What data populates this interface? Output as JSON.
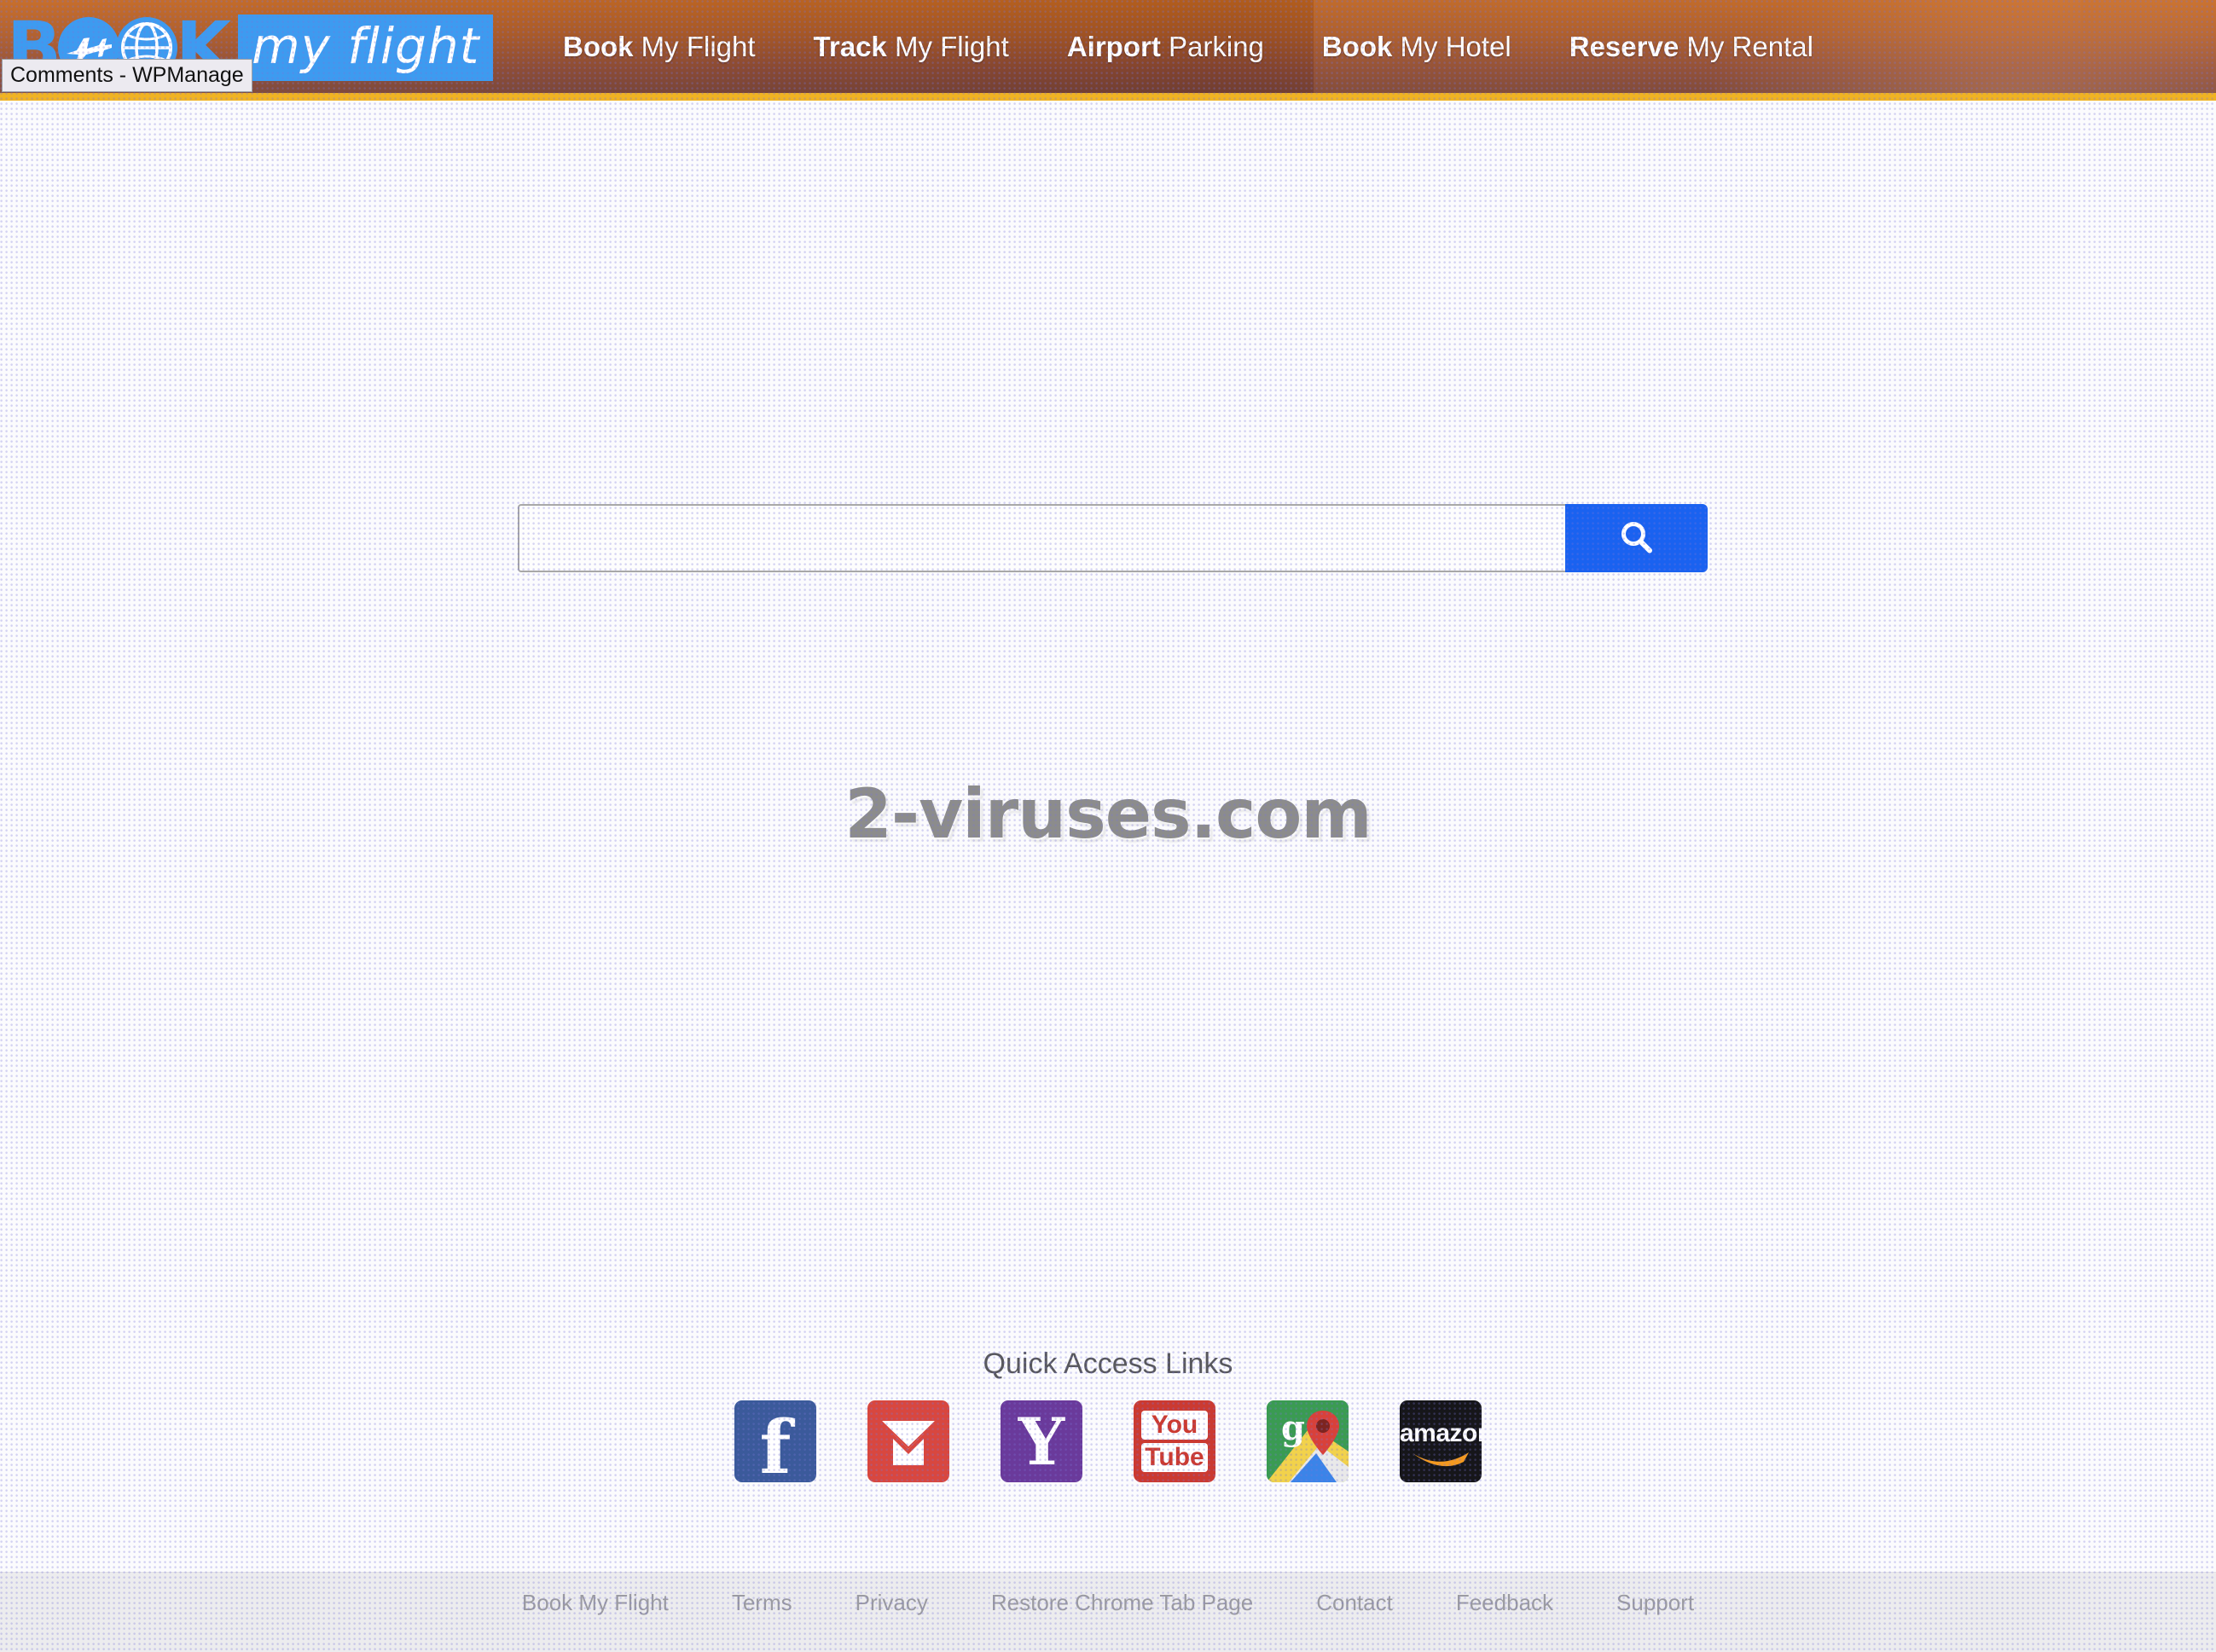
{
  "header": {
    "logo": {
      "book_text": "BOOK",
      "book_letters": [
        "B",
        "K"
      ],
      "plane_icon": "plane-icon",
      "globe_icon": "globe-icon",
      "myflight_text": "my flight",
      "logo_blue": "#3d9bf0"
    },
    "nav": [
      {
        "bold": "Book",
        "rest": " My Flight"
      },
      {
        "bold": "Track",
        "rest": " My Flight"
      },
      {
        "bold": "Airport",
        "rest": " Parking"
      },
      {
        "bold": "Book",
        "rest": " My Hotel"
      },
      {
        "bold": "Reserve",
        "rest": " My Rental"
      }
    ],
    "accent_border": "#f0b323",
    "background": "#b05a24"
  },
  "tooltip": {
    "text": "Comments - WPManage"
  },
  "search": {
    "value": "",
    "placeholder": "",
    "button_icon": "search-icon",
    "button_color": "#1a62f0"
  },
  "watermark": {
    "text": "2-viruses.com",
    "color": "#8c8c8c"
  },
  "quick_access": {
    "title": "Quick Access Links",
    "items": [
      {
        "name": "facebook",
        "label": "f",
        "icon": "facebook-icon",
        "color": "#3b5a9b"
      },
      {
        "name": "gmail",
        "label": "",
        "icon": "gmail-icon",
        "color": "#d8473f"
      },
      {
        "name": "yahoo",
        "label": "Y",
        "icon": "yahoo-icon",
        "color": "#6a3a9b"
      },
      {
        "name": "youtube",
        "label_top": "You",
        "label_bottom": "Tube",
        "icon": "youtube-icon",
        "color": "#cb3a31"
      },
      {
        "name": "maps",
        "label": "g",
        "icon": "google-maps-icon",
        "color": "#3a9b52"
      },
      {
        "name": "amazon",
        "label": "amazon",
        "icon": "amazon-icon",
        "color": "#16161a"
      }
    ]
  },
  "footer": {
    "links": [
      "Book My Flight",
      "Terms",
      "Privacy",
      "Restore Chrome Tab Page",
      "Contact",
      "Feedback",
      "Support"
    ]
  }
}
